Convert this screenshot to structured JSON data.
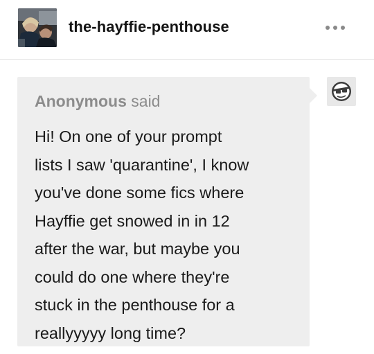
{
  "post": {
    "blog_name": "the-hayffie-penthouse",
    "more_icon": "ellipsis-icon",
    "ask": {
      "asker": "Anonymous",
      "said": "said",
      "avatar_icon": "anonymous-sunglasses-icon",
      "lines": [
        "Hi! On one of your prompt",
        "lists I saw 'quarantine', I know",
        "you've done some fics where",
        "Hayffie get snowed in in 12",
        "after the war, but maybe you",
        "could do one where they're",
        "stuck in the penthouse for a",
        "reallyyyyy long time?"
      ]
    }
  },
  "colors": {
    "bubble_background": "#eeeeee",
    "asker_text": "#8c8c8c",
    "body_text": "#1a1a1a",
    "divider": "#e3e3e3"
  }
}
